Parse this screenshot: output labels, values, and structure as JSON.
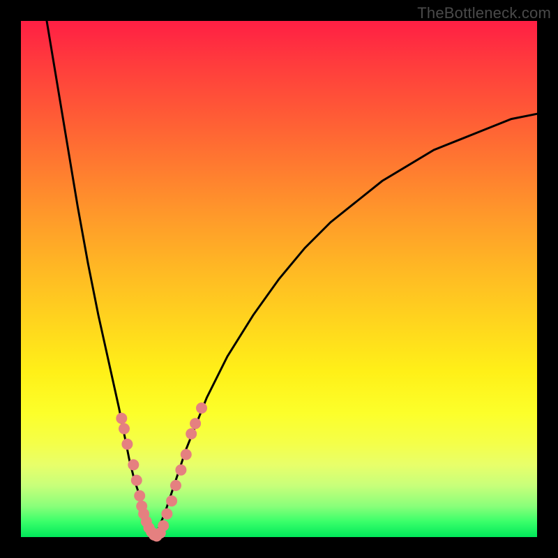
{
  "watermark": "TheBottleneck.com",
  "colors": {
    "frame": "#000000",
    "curve": "#000000",
    "dot": "#e58080"
  },
  "chart_data": {
    "type": "line",
    "title": "",
    "xlabel": "",
    "ylabel": "",
    "xlim": [
      0,
      100
    ],
    "ylim": [
      0,
      100
    ],
    "note": "No numeric axes or tick labels are rendered; values below are normalized 0-100 along each axis.",
    "grid": false,
    "legend": false,
    "series": [
      {
        "name": "left-branch",
        "x": [
          5,
          7,
          9,
          11,
          13,
          15,
          17,
          19,
          20,
          21,
          22,
          23,
          24,
          25,
          26
        ],
        "y": [
          100,
          88,
          76,
          64,
          53,
          43,
          34,
          25,
          20,
          15,
          11,
          8,
          5,
          2,
          0
        ]
      },
      {
        "name": "right-branch",
        "x": [
          26,
          28,
          30,
          32,
          34,
          36,
          40,
          45,
          50,
          55,
          60,
          65,
          70,
          75,
          80,
          85,
          90,
          95,
          100
        ],
        "y": [
          0,
          5,
          11,
          17,
          22,
          27,
          35,
          43,
          50,
          56,
          61,
          65,
          69,
          72,
          75,
          77,
          79,
          81,
          82
        ]
      }
    ],
    "dots": {
      "name": "sample-points",
      "left": [
        {
          "x": 19.5,
          "y": 23
        },
        {
          "x": 20.0,
          "y": 21
        },
        {
          "x": 20.6,
          "y": 18
        },
        {
          "x": 21.8,
          "y": 14
        },
        {
          "x": 22.4,
          "y": 11
        },
        {
          "x": 23.0,
          "y": 8
        },
        {
          "x": 23.4,
          "y": 6
        },
        {
          "x": 23.8,
          "y": 4.5
        },
        {
          "x": 24.3,
          "y": 3
        },
        {
          "x": 24.8,
          "y": 1.8
        },
        {
          "x": 25.3,
          "y": 1
        },
        {
          "x": 25.8,
          "y": 0.4
        },
        {
          "x": 26.3,
          "y": 0.2
        }
      ],
      "right": [
        {
          "x": 27.0,
          "y": 0.8
        },
        {
          "x": 27.6,
          "y": 2.2
        },
        {
          "x": 28.3,
          "y": 4.5
        },
        {
          "x": 29.2,
          "y": 7
        },
        {
          "x": 30.0,
          "y": 10
        },
        {
          "x": 31.0,
          "y": 13
        },
        {
          "x": 32.0,
          "y": 16
        },
        {
          "x": 33.0,
          "y": 20
        },
        {
          "x": 33.8,
          "y": 22
        },
        {
          "x": 35.0,
          "y": 25
        }
      ]
    }
  }
}
